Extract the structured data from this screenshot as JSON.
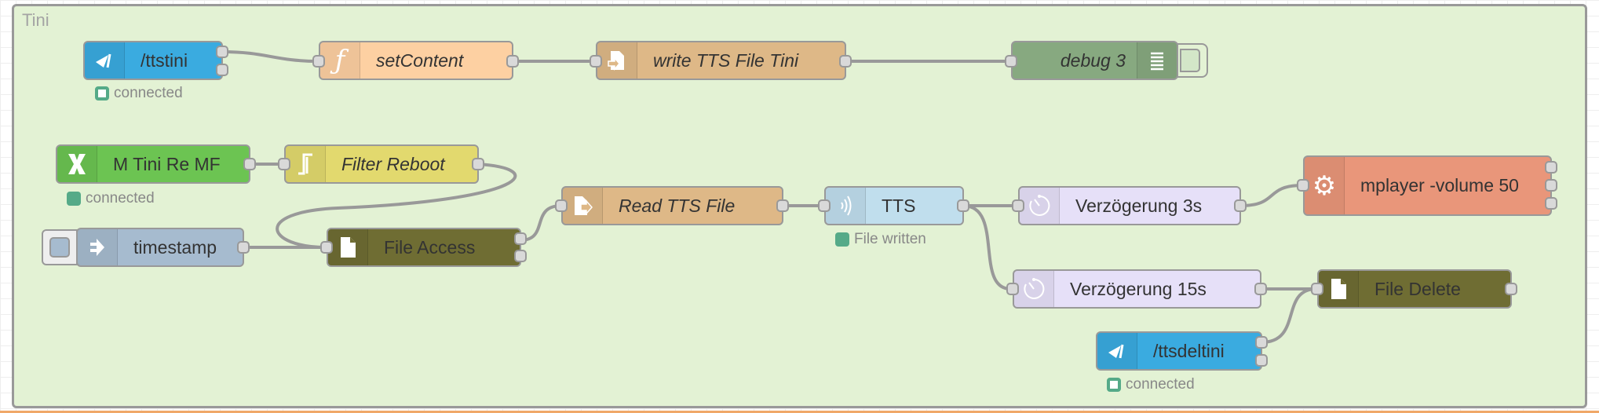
{
  "group": {
    "label": "Tini",
    "color": "#e3f2d4"
  },
  "nodes": {
    "ttstini": {
      "label": "/ttstini",
      "type": "telegram-command",
      "color": "#3aabe0",
      "status": "connected"
    },
    "setContent": {
      "label": "setContent",
      "type": "function",
      "color": "#fdd0a2"
    },
    "writeTTS": {
      "label": "write TTS File Tini",
      "type": "file-write",
      "color": "#deb887"
    },
    "debug3": {
      "label": "debug 3",
      "type": "debug",
      "color": "#87a980"
    },
    "mTini": {
      "label": "M Tini Re MF",
      "type": "mqtt-x",
      "color": "#6cc452",
      "status": "connected"
    },
    "filterReboot": {
      "label": "Filter Reboot",
      "type": "filter",
      "color": "#e2d96e"
    },
    "timestamp": {
      "label": "timestamp",
      "type": "inject",
      "color": "#a6bbcf"
    },
    "fileAccess": {
      "label": "File Access",
      "type": "file",
      "color": "#6f6d33"
    },
    "readTTS": {
      "label": "Read TTS File",
      "type": "file-read",
      "color": "#deb887"
    },
    "tts": {
      "label": "TTS",
      "type": "tts",
      "color": "#c0deed",
      "status": "File written"
    },
    "delay3": {
      "label": "Verzögerung 3s",
      "type": "delay",
      "color": "#e6e0f8"
    },
    "mplayer": {
      "label": "mplayer -volume 50",
      "type": "exec",
      "color": "#e9967a"
    },
    "delay15": {
      "label": "Verzögerung 15s",
      "type": "delay",
      "color": "#e6e0f8"
    },
    "fileDelete": {
      "label": "File Delete",
      "type": "file",
      "color": "#6f6d33"
    },
    "ttsdeltini": {
      "label": "/ttsdeltini",
      "type": "telegram-command",
      "color": "#3aabe0",
      "status": "connected"
    }
  },
  "status_colors": {
    "connected": "#55aa88"
  }
}
